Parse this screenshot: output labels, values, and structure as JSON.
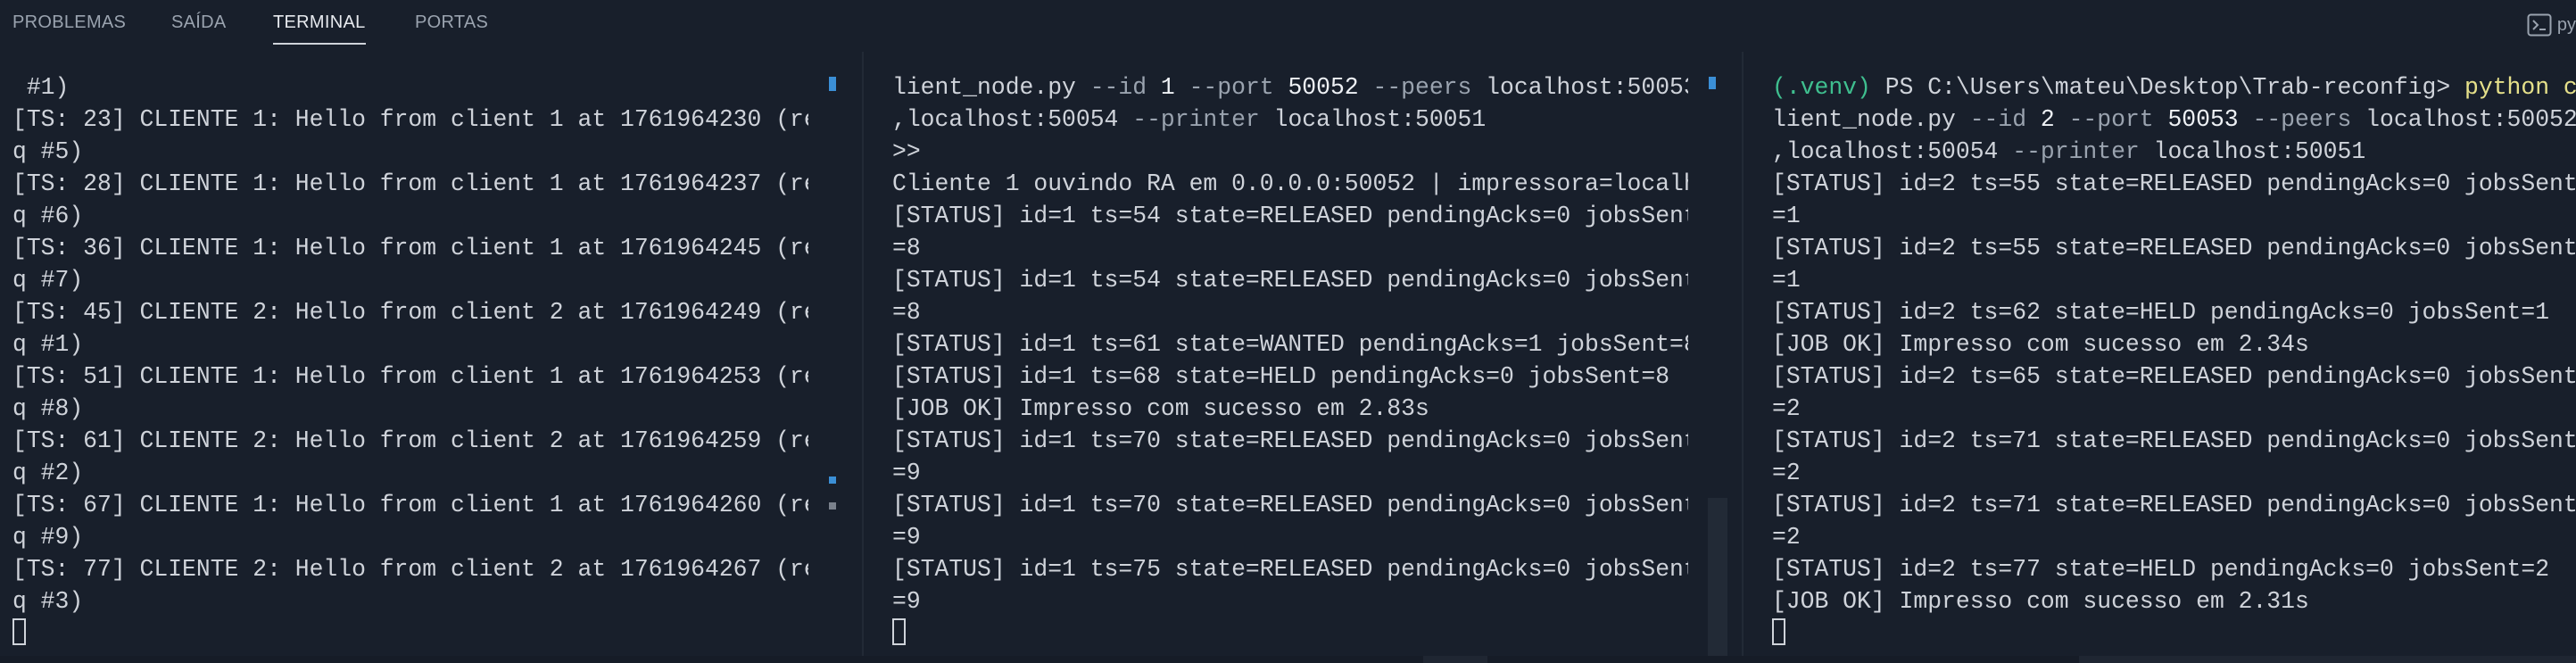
{
  "tabs": [
    {
      "label": "PROBLEMAS",
      "active": false
    },
    {
      "label": "SAÍDA",
      "active": false
    },
    {
      "label": "TERMINAL",
      "active": true
    },
    {
      "label": "PORTAS",
      "active": false
    }
  ],
  "terminal_launch": {
    "label": "py"
  },
  "panes": [
    {
      "name": "terminal-pane-1",
      "lines": [
        [
          {
            "t": " #1)"
          }
        ],
        [
          {
            "t": "[TS: 23] CLIENTE 1: Hello from client 1 at 1761964230 (re"
          }
        ],
        [
          {
            "t": "q #5)"
          }
        ],
        [
          {
            "t": "[TS: 28] CLIENTE 1: Hello from client 1 at 1761964237 (re"
          }
        ],
        [
          {
            "t": "q #6)"
          }
        ],
        [
          {
            "t": "[TS: 36] CLIENTE 1: Hello from client 1 at 1761964245 (re"
          }
        ],
        [
          {
            "t": "q #7)"
          }
        ],
        [
          {
            "t": "[TS: 45] CLIENTE 2: Hello from client 2 at 1761964249 (re"
          }
        ],
        [
          {
            "t": "q #1)"
          }
        ],
        [
          {
            "t": "[TS: 51] CLIENTE 1: Hello from client 1 at 1761964253 (re"
          }
        ],
        [
          {
            "t": "q #8)"
          }
        ],
        [
          {
            "t": "[TS: 61] CLIENTE 2: Hello from client 2 at 1761964259 (re"
          }
        ],
        [
          {
            "t": "q #2)"
          }
        ],
        [
          {
            "t": "[TS: 67] CLIENTE 1: Hello from client 1 at 1761964260 (re"
          }
        ],
        [
          {
            "t": "q #9)"
          }
        ],
        [
          {
            "t": "[TS: 77] CLIENTE 2: Hello from client 2 at 1761964267 (re"
          }
        ],
        [
          {
            "t": "q #3)"
          }
        ],
        []
      ]
    },
    {
      "name": "terminal-pane-2",
      "lines": [
        [
          {
            "t": "lient_node.py "
          },
          {
            "t": "--id",
            "c": "dim"
          },
          {
            "t": " 1 ",
            "c": "bright"
          },
          {
            "t": "--port",
            "c": "dim"
          },
          {
            "t": " 50052 ",
            "c": "bright"
          },
          {
            "t": "--peers",
            "c": "dim"
          },
          {
            "t": " localhost:50053"
          }
        ],
        [
          {
            "t": ",localhost:50054 "
          },
          {
            "t": "--printer",
            "c": "dim"
          },
          {
            "t": " localhost:50051"
          }
        ],
        [
          {
            "t": ">>"
          }
        ],
        [
          {
            "t": "Cliente 1 ouvindo RA em 0.0.0.0:50052 | impressora=localh"
          }
        ],
        [
          {
            "t": "[STATUS] id=1 ts=54 state=RELEASED pendingAcks=0 jobsSent"
          }
        ],
        [
          {
            "t": "=8"
          }
        ],
        [
          {
            "t": "[STATUS] id=1 ts=54 state=RELEASED pendingAcks=0 jobsSent"
          }
        ],
        [
          {
            "t": "=8"
          }
        ],
        [
          {
            "t": "[STATUS] id=1 ts=61 state=WANTED pendingAcks=1 jobsSent=8"
          }
        ],
        [
          {
            "t": "[STATUS] id=1 ts=68 state=HELD pendingAcks=0 jobsSent=8"
          }
        ],
        [
          {
            "t": "[JOB OK] Impresso com sucesso em 2.83s"
          }
        ],
        [
          {
            "t": "[STATUS] id=1 ts=70 state=RELEASED pendingAcks=0 jobsSent"
          }
        ],
        [
          {
            "t": "=9"
          }
        ],
        [
          {
            "t": "[STATUS] id=1 ts=70 state=RELEASED pendingAcks=0 jobsSent"
          }
        ],
        [
          {
            "t": "=9"
          }
        ],
        [
          {
            "t": "[STATUS] id=1 ts=75 state=RELEASED pendingAcks=0 jobsSent"
          }
        ],
        [
          {
            "t": "=9"
          }
        ],
        []
      ]
    },
    {
      "name": "terminal-pane-3",
      "lines": [
        [
          {
            "t": "(.venv) ",
            "c": "green"
          },
          {
            "t": "PS C:\\Users\\mateu\\Desktop\\Trab-reconfig> "
          },
          {
            "t": "python c",
            "c": "yellow"
          }
        ],
        [
          {
            "t": "lient_node.py "
          },
          {
            "t": "--id",
            "c": "dim"
          },
          {
            "t": " 2 ",
            "c": "bright"
          },
          {
            "t": "--port",
            "c": "dim"
          },
          {
            "t": " 50053 ",
            "c": "bright"
          },
          {
            "t": "--peers",
            "c": "dim"
          },
          {
            "t": " localhost:50052"
          }
        ],
        [
          {
            "t": ",localhost:50054 "
          },
          {
            "t": "--printer",
            "c": "dim"
          },
          {
            "t": " localhost:50051"
          }
        ],
        [
          {
            "t": "[STATUS] id=2 ts=55 state=RELEASED pendingAcks=0 jobsSent"
          }
        ],
        [
          {
            "t": "=1"
          }
        ],
        [
          {
            "t": "[STATUS] id=2 ts=55 state=RELEASED pendingAcks=0 jobsSent"
          }
        ],
        [
          {
            "t": "=1"
          }
        ],
        [
          {
            "t": "[STATUS] id=2 ts=62 state=HELD pendingAcks=0 jobsSent=1"
          }
        ],
        [
          {
            "t": "[JOB OK] Impresso com sucesso em 2.34s"
          }
        ],
        [
          {
            "t": "[STATUS] id=2 ts=65 state=RELEASED pendingAcks=0 jobsSent"
          }
        ],
        [
          {
            "t": "=2"
          }
        ],
        [
          {
            "t": "[STATUS] id=2 ts=71 state=RELEASED pendingAcks=0 jobsSent"
          }
        ],
        [
          {
            "t": "=2"
          }
        ],
        [
          {
            "t": "[STATUS] id=2 ts=71 state=RELEASED pendingAcks=0 jobsSent"
          }
        ],
        [
          {
            "t": "=2"
          }
        ],
        [
          {
            "t": "[STATUS] id=2 ts=77 state=HELD pendingAcks=0 jobsSent=2"
          }
        ],
        [
          {
            "t": "[JOB OK] Impresso com sucesso em 2.31s"
          }
        ],
        []
      ]
    }
  ]
}
